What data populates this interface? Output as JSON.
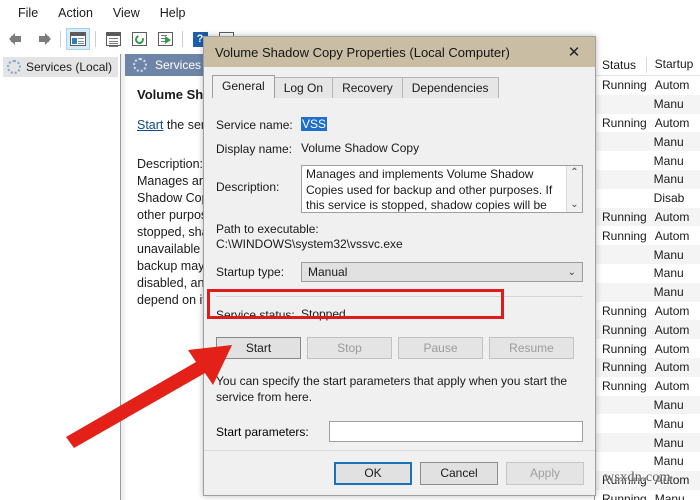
{
  "app": {
    "menu": [
      "File",
      "Action",
      "View",
      "Help"
    ],
    "toolbar_icons": [
      "back-arrow-icon",
      "forward-arrow-icon",
      "show-hide-console-tree-icon",
      "properties-icon",
      "refresh-icon",
      "export-list-icon",
      "help-icon",
      "start-service-icon"
    ]
  },
  "tree": {
    "root_label": "Services (Local)"
  },
  "detail": {
    "header": "Services (Local)",
    "service_title": "Volume Shadow Copy",
    "action_link": "Start",
    "action_rest": " the service",
    "description_label": "Description:",
    "description_lines": [
      "Manages and",
      "Shadow Cop",
      "other purpos",
      "stopped, sha",
      "unavailable f",
      "backup may",
      "disabled, any",
      "depend on it"
    ]
  },
  "list": {
    "columns": [
      "Status",
      "Startup"
    ],
    "rows": [
      {
        "status": "Running",
        "startup": "Autom"
      },
      {
        "status": "",
        "startup": "Manu"
      },
      {
        "status": "Running",
        "startup": "Autom"
      },
      {
        "status": "",
        "startup": "Manu"
      },
      {
        "status": "",
        "startup": "Manu"
      },
      {
        "status": "",
        "startup": "Manu"
      },
      {
        "status": "",
        "startup": "Disab"
      },
      {
        "status": "Running",
        "startup": "Autom"
      },
      {
        "status": "Running",
        "startup": "Autom"
      },
      {
        "status": "",
        "startup": "Manu"
      },
      {
        "status": "",
        "startup": "Manu"
      },
      {
        "status": "",
        "startup": "Manu"
      },
      {
        "status": "Running",
        "startup": "Autom"
      },
      {
        "status": "Running",
        "startup": "Autom"
      },
      {
        "status": "Running",
        "startup": "Autom"
      },
      {
        "status": "Running",
        "startup": "Autom"
      },
      {
        "status": "Running",
        "startup": "Autom"
      },
      {
        "status": "",
        "startup": "Manu"
      },
      {
        "status": "",
        "startup": "Manu"
      },
      {
        "status": "",
        "startup": "Manu"
      },
      {
        "status": "",
        "startup": "Manu"
      },
      {
        "status": "Running",
        "startup": "Autom"
      },
      {
        "status": "Running",
        "startup": "Manu"
      }
    ],
    "watermark": "wsxdn.com"
  },
  "dialog": {
    "title": "Volume Shadow Copy Properties (Local Computer)",
    "close_label": "✕",
    "tabs": [
      {
        "label": "General",
        "active": true
      },
      {
        "label": "Log On",
        "active": false
      },
      {
        "label": "Recovery",
        "active": false
      },
      {
        "label": "Dependencies",
        "active": false
      }
    ],
    "fields": {
      "service_name_label": "Service name:",
      "service_name_value": "VSS",
      "display_name_label": "Display name:",
      "display_name_value": "Volume Shadow Copy",
      "description_label": "Description:",
      "description_value": "Manages and implements Volume Shadow Copies used for backup and other purposes. If this service is stopped, shadow copies will be unavailable for",
      "path_label": "Path to executable:",
      "path_value": "C:\\WINDOWS\\system32\\vssvc.exe",
      "startup_type_label": "Startup type:",
      "startup_type_value": "Manual",
      "service_status_label": "Service status:",
      "service_status_value": "Stopped",
      "hint_text": "You can specify the start parameters that apply when you start the service from here.",
      "start_params_label": "Start parameters:",
      "start_params_value": "",
      "start_params_placeholder": ""
    },
    "service_buttons": [
      {
        "label": "Start",
        "disabled": false
      },
      {
        "label": "Stop",
        "disabled": true
      },
      {
        "label": "Pause",
        "disabled": true
      },
      {
        "label": "Resume",
        "disabled": true
      }
    ],
    "footer_buttons": [
      {
        "label": "OK",
        "disabled": false,
        "focused": true
      },
      {
        "label": "Cancel",
        "disabled": false,
        "focused": false
      },
      {
        "label": "Apply",
        "disabled": true,
        "focused": false
      }
    ],
    "scroll_up_glyph": "⌃",
    "scroll_down_glyph": "⌄",
    "combo_chevron": "⌄"
  },
  "annotations": {
    "highlight_color": "#e01b1b",
    "arrow_color": "#e32119"
  }
}
